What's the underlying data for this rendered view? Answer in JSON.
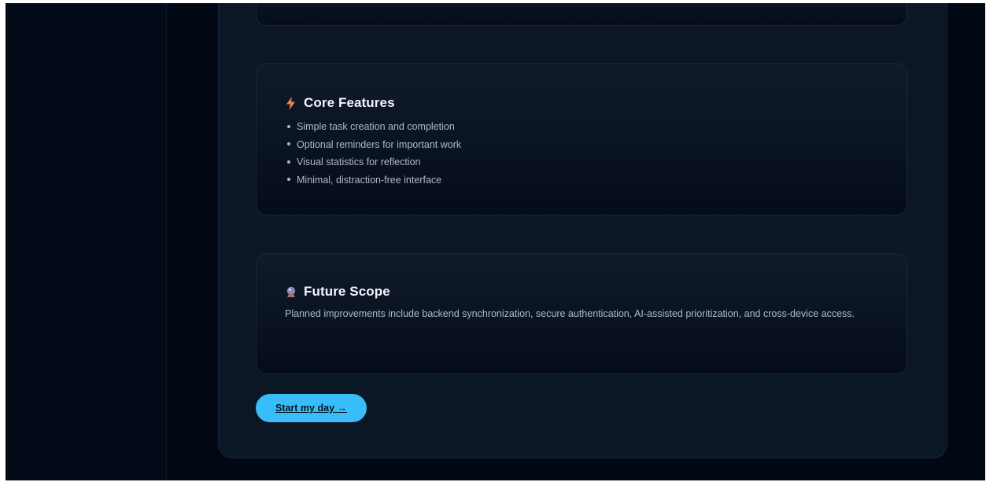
{
  "colors": {
    "page_background": "#020714",
    "panel_background": "#0c1726",
    "card_background": "#0a1322",
    "heading_text": "#f2f5fb",
    "body_text": "#aeb9ca",
    "accent_button": "#38bdf8",
    "lightning_icon": "#f4854a"
  },
  "features_card": {
    "icon": "lightning-icon",
    "title": "Core Features",
    "items": [
      "Simple task creation and completion",
      "Optional reminders for important work",
      "Visual statistics for reflection",
      "Minimal, distraction-free interface"
    ]
  },
  "future_card": {
    "icon": "crystal-ball-icon",
    "title": "Future Scope",
    "text": "Planned improvements include backend synchronization, secure authentication, AI-assisted prioritization, and cross-device access."
  },
  "cta": {
    "label": "Start my day →"
  }
}
